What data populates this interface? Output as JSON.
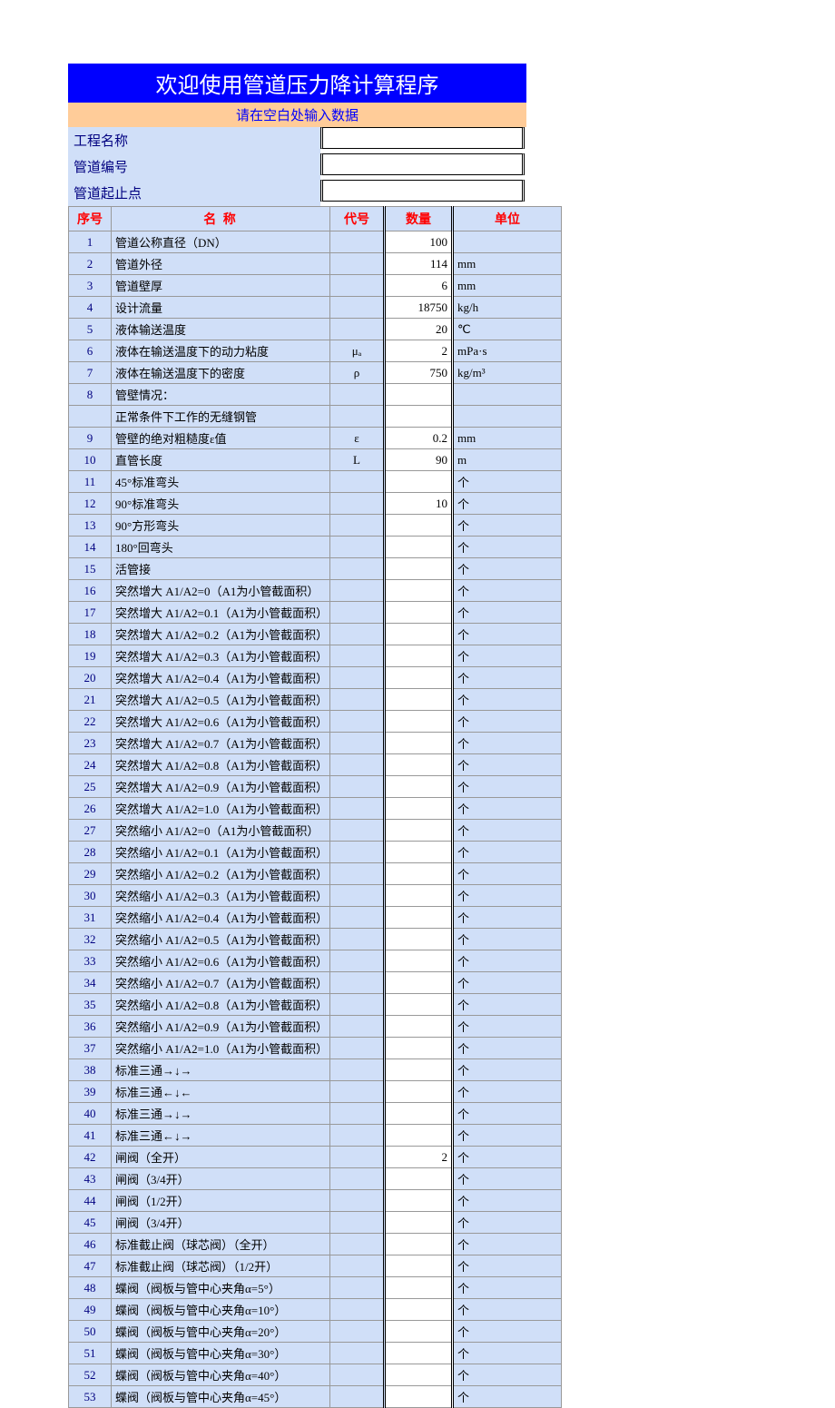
{
  "title": "欢迎使用管道压力降计算程序",
  "prompt": "请在空白处输入数据",
  "info": [
    {
      "label": "工程名称",
      "value": ""
    },
    {
      "label": "管道编号",
      "value": ""
    },
    {
      "label": "管道起止点",
      "value": ""
    }
  ],
  "headers": {
    "seq": "序号",
    "name": "名                         称",
    "code": "代号",
    "qty": "数量",
    "unit": "单位"
  },
  "rows": [
    {
      "seq": "1",
      "name": "管道公称直径（DN）",
      "code": "",
      "qty": "100",
      "unit": ""
    },
    {
      "seq": "2",
      "name": "管道外径",
      "code": "",
      "qty": "114",
      "unit": "mm"
    },
    {
      "seq": "3",
      "name": "管道壁厚",
      "code": "",
      "qty": "6",
      "unit": "mm"
    },
    {
      "seq": "4",
      "name": "设计流量",
      "code": "",
      "qty": "18750",
      "unit": "kg/h"
    },
    {
      "seq": "5",
      "name": "液体输送温度",
      "code": "",
      "qty": "20",
      "unit": "℃"
    },
    {
      "seq": "6",
      "name": "液体在输送温度下的动力粘度",
      "code": "μₐ",
      "qty": "2",
      "unit": "mPa·s"
    },
    {
      "seq": "7",
      "name": "液体在输送温度下的密度",
      "code": "ρ",
      "qty": "750",
      "unit": "kg/m³"
    },
    {
      "seq": "8",
      "name": "管壁情况：",
      "code": "",
      "qty": "",
      "unit": ""
    },
    {
      "seq": "",
      "name": "正常条件下工作的无缝钢管",
      "code": "",
      "qty": "",
      "unit": "",
      "sub": true
    },
    {
      "seq": "9",
      "name": "管壁的绝对粗糙度ε值",
      "code": "ε",
      "qty": "0.2",
      "unit": "mm"
    },
    {
      "seq": "10",
      "name": "直管长度",
      "code": "L",
      "qty": "90",
      "unit": "m"
    },
    {
      "seq": "11",
      "name": "45°标准弯头",
      "code": "",
      "qty": "",
      "unit": "个"
    },
    {
      "seq": "12",
      "name": "90°标准弯头",
      "code": "",
      "qty": "10",
      "unit": "个"
    },
    {
      "seq": "13",
      "name": "90°方形弯头",
      "code": "",
      "qty": "",
      "unit": "个"
    },
    {
      "seq": "14",
      "name": "180°回弯头",
      "code": "",
      "qty": "",
      "unit": "个"
    },
    {
      "seq": "15",
      "name": "活管接",
      "code": "",
      "qty": "",
      "unit": "个"
    },
    {
      "seq": "16",
      "name": "突然增大  A1/A2=0（A1为小管截面积）",
      "code": "",
      "qty": "",
      "unit": "个"
    },
    {
      "seq": "17",
      "name": "突然增大  A1/A2=0.1（A1为小管截面积）",
      "code": "",
      "qty": "",
      "unit": "个"
    },
    {
      "seq": "18",
      "name": "突然增大  A1/A2=0.2（A1为小管截面积）",
      "code": "",
      "qty": "",
      "unit": "个"
    },
    {
      "seq": "19",
      "name": "突然增大  A1/A2=0.3（A1为小管截面积）",
      "code": "",
      "qty": "",
      "unit": "个"
    },
    {
      "seq": "20",
      "name": "突然增大  A1/A2=0.4（A1为小管截面积）",
      "code": "",
      "qty": "",
      "unit": "个"
    },
    {
      "seq": "21",
      "name": "突然增大  A1/A2=0.5（A1为小管截面积）",
      "code": "",
      "qty": "",
      "unit": "个"
    },
    {
      "seq": "22",
      "name": "突然增大  A1/A2=0.6（A1为小管截面积）",
      "code": "",
      "qty": "",
      "unit": "个"
    },
    {
      "seq": "23",
      "name": "突然增大  A1/A2=0.7（A1为小管截面积）",
      "code": "",
      "qty": "",
      "unit": "个"
    },
    {
      "seq": "24",
      "name": "突然增大  A1/A2=0.8（A1为小管截面积）",
      "code": "",
      "qty": "",
      "unit": "个"
    },
    {
      "seq": "25",
      "name": "突然增大  A1/A2=0.9（A1为小管截面积）",
      "code": "",
      "qty": "",
      "unit": "个"
    },
    {
      "seq": "26",
      "name": "突然增大  A1/A2=1.0（A1为小管截面积）",
      "code": "",
      "qty": "",
      "unit": "个"
    },
    {
      "seq": "27",
      "name": "突然缩小  A1/A2=0（A1为小管截面积）",
      "code": "",
      "qty": "",
      "unit": "个"
    },
    {
      "seq": "28",
      "name": "突然缩小  A1/A2=0.1（A1为小管截面积）",
      "code": "",
      "qty": "",
      "unit": "个"
    },
    {
      "seq": "29",
      "name": "突然缩小  A1/A2=0.2（A1为小管截面积）",
      "code": "",
      "qty": "",
      "unit": "个"
    },
    {
      "seq": "30",
      "name": "突然缩小  A1/A2=0.3（A1为小管截面积）",
      "code": "",
      "qty": "",
      "unit": "个"
    },
    {
      "seq": "31",
      "name": "突然缩小  A1/A2=0.4（A1为小管截面积）",
      "code": "",
      "qty": "",
      "unit": "个"
    },
    {
      "seq": "32",
      "name": "突然缩小  A1/A2=0.5（A1为小管截面积）",
      "code": "",
      "qty": "",
      "unit": "个"
    },
    {
      "seq": "33",
      "name": "突然缩小  A1/A2=0.6（A1为小管截面积）",
      "code": "",
      "qty": "",
      "unit": "个"
    },
    {
      "seq": "34",
      "name": "突然缩小  A1/A2=0.7（A1为小管截面积）",
      "code": "",
      "qty": "",
      "unit": "个"
    },
    {
      "seq": "35",
      "name": "突然缩小  A1/A2=0.8（A1为小管截面积）",
      "code": "",
      "qty": "",
      "unit": "个"
    },
    {
      "seq": "36",
      "name": "突然缩小  A1/A2=0.9（A1为小管截面积）",
      "code": "",
      "qty": "",
      "unit": "个"
    },
    {
      "seq": "37",
      "name": "突然缩小  A1/A2=1.0（A1为小管截面积）",
      "code": "",
      "qty": "",
      "unit": "个"
    },
    {
      "seq": "38",
      "name": "标准三通→↓→",
      "code": "",
      "qty": "",
      "unit": "个"
    },
    {
      "seq": "39",
      "name": "标准三通←↓←",
      "code": "",
      "qty": "",
      "unit": "个"
    },
    {
      "seq": "40",
      "name": "标准三通→↓→",
      "code": "",
      "qty": "",
      "unit": "个"
    },
    {
      "seq": "41",
      "name": "标准三通←↓→",
      "code": "",
      "qty": "",
      "unit": "个"
    },
    {
      "seq": "42",
      "name": "闸阀（全开）",
      "code": "",
      "qty": "2",
      "unit": "个"
    },
    {
      "seq": "43",
      "name": "闸阀（3/4开）",
      "code": "",
      "qty": "",
      "unit": "个"
    },
    {
      "seq": "44",
      "name": "闸阀（1/2开）",
      "code": "",
      "qty": "",
      "unit": "个"
    },
    {
      "seq": "45",
      "name": "闸阀（3/4开）",
      "code": "",
      "qty": "",
      "unit": "个"
    },
    {
      "seq": "46",
      "name": "标准截止阀（球芯阀）（全开）",
      "code": "",
      "qty": "",
      "unit": "个"
    },
    {
      "seq": "47",
      "name": "标准截止阀（球芯阀）（1/2开）",
      "code": "",
      "qty": "",
      "unit": "个"
    },
    {
      "seq": "48",
      "name": "蝶阀（阀板与管中心夹角α=5°）",
      "code": "",
      "qty": "",
      "unit": "个"
    },
    {
      "seq": "49",
      "name": "蝶阀（阀板与管中心夹角α=10°）",
      "code": "",
      "qty": "",
      "unit": "个"
    },
    {
      "seq": "50",
      "name": "蝶阀（阀板与管中心夹角α=20°）",
      "code": "",
      "qty": "",
      "unit": "个"
    },
    {
      "seq": "51",
      "name": "蝶阀（阀板与管中心夹角α=30°）",
      "code": "",
      "qty": "",
      "unit": "个"
    },
    {
      "seq": "52",
      "name": "蝶阀（阀板与管中心夹角α=40°）",
      "code": "",
      "qty": "",
      "unit": "个"
    },
    {
      "seq": "53",
      "name": "蝶阀（阀板与管中心夹角α=45°）",
      "code": "",
      "qty": "",
      "unit": "个"
    }
  ]
}
